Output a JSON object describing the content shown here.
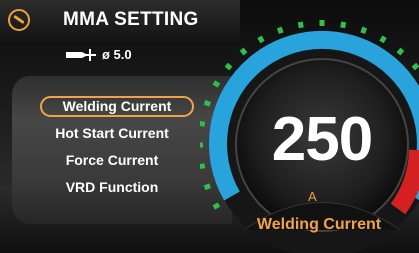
{
  "header": {
    "title": "MMA SETTING",
    "icon": "electrode-holder-icon"
  },
  "electrode": {
    "icon": "electrode-rod-icon",
    "label": "ø 5.0"
  },
  "menu": {
    "items": [
      {
        "label": "Welding Current",
        "selected": true
      },
      {
        "label": "Hot Start Current",
        "selected": false
      },
      {
        "label": "Force Current",
        "selected": false
      },
      {
        "label": "VRD Function",
        "selected": false
      }
    ]
  },
  "gauge": {
    "value": "250",
    "unit": "A",
    "parameter": "Welding Current",
    "colors": {
      "scale": "#29a3dc",
      "limit": "#d32020",
      "ticks": "#2fbf4a",
      "accent": "#f2a34a"
    }
  }
}
